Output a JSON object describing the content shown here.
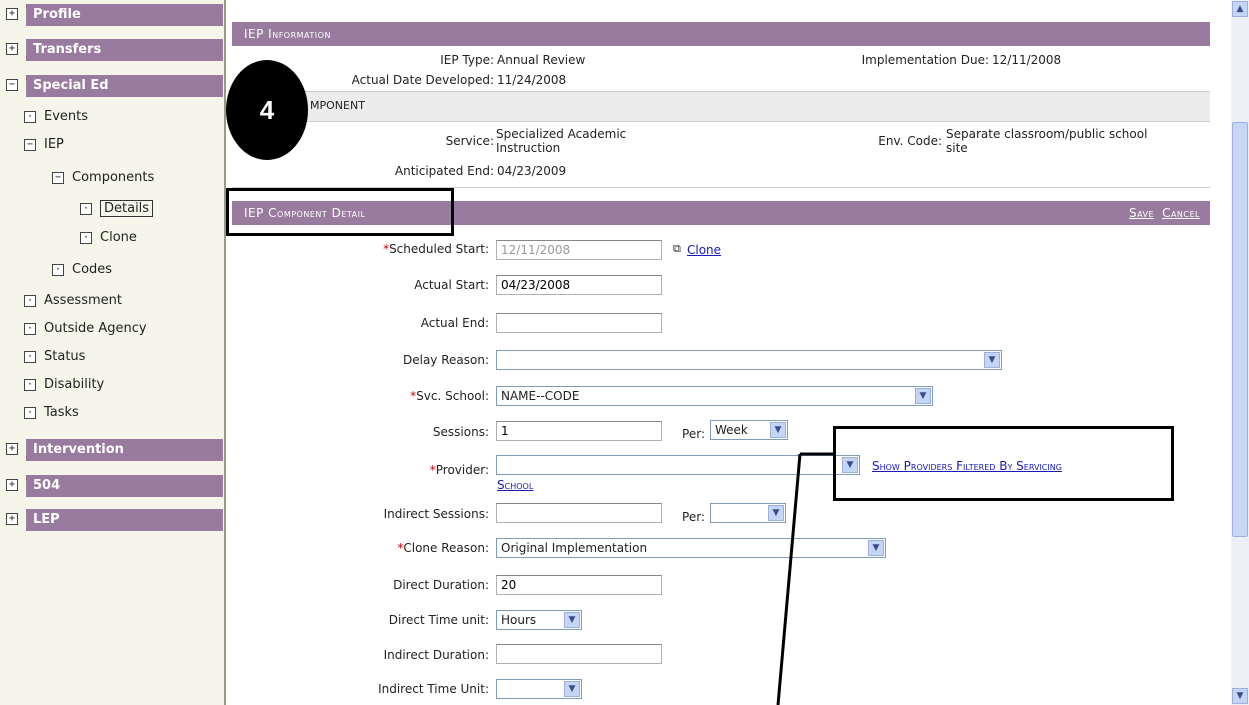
{
  "sidebar": {
    "sections": [
      {
        "label": "Profile",
        "sign": "+"
      },
      {
        "label": "Transfers",
        "sign": "+"
      },
      {
        "label": "Special Ed",
        "sign": "−"
      },
      {
        "label": "Intervention",
        "sign": "+"
      },
      {
        "label": "504",
        "sign": "+"
      },
      {
        "label": "LEP",
        "sign": "+"
      }
    ],
    "tree": {
      "events": "Events",
      "iep": "IEP",
      "components": "Components",
      "details": "Details",
      "clone": "Clone",
      "codes": "Codes",
      "assessment": "Assessment",
      "outside_agency": "Outside Agency",
      "status": "Status",
      "disability": "Disability",
      "tasks": "Tasks"
    }
  },
  "iep_info": {
    "header": "IEP Information",
    "iep_type_label": "IEP Type:",
    "iep_type": "Annual Review",
    "impl_due_label": "Implementation Due:",
    "impl_due": "12/11/2008",
    "actual_dev_label": "Actual Date Developed:",
    "actual_dev": "11/24/2008",
    "component_header": "MPONENT",
    "service_label": "Service:",
    "service_line1": "Specialized Academic",
    "service_line2": "Instruction",
    "env_label": "Env. Code:",
    "env_line1": "Separate classroom/public school",
    "env_line2": "site",
    "anticipated_label": "Anticipated End:",
    "anticipated": "04/23/2009"
  },
  "detail": {
    "header": "IEP Component Detail",
    "save": "Save",
    "cancel": "Cancel",
    "scheduled_start_label": "Scheduled Start:",
    "scheduled_start": "12/11/2008",
    "clone_link": "Clone",
    "actual_start_label": "Actual Start:",
    "actual_start": "04/23/2008",
    "actual_end_label": "Actual End:",
    "actual_end": "",
    "delay_reason_label": "Delay Reason:",
    "delay_reason": "",
    "svc_school_label": "Svc. School:",
    "svc_school": "NAME--CODE",
    "sessions_label": "Sessions:",
    "sessions": "1",
    "per_label": "Per:",
    "per": "Week",
    "provider_label": "Provider:",
    "provider": "",
    "show_providers_1": "Show Providers Filtered By Servicing",
    "show_providers_2": "School",
    "indirect_sessions_label": "Indirect Sessions:",
    "indirect_sessions": "",
    "per2_label": "Per:",
    "per2": "",
    "clone_reason_label": "Clone Reason:",
    "clone_reason": "Original Implementation",
    "direct_duration_label": "Direct Duration:",
    "direct_duration": "20",
    "direct_time_unit_label": "Direct Time unit:",
    "direct_time_unit": "Hours",
    "indirect_duration_label": "Indirect Duration:",
    "indirect_duration": "",
    "indirect_time_unit_label": "Indirect Time Unit:",
    "indirect_time_unit": ""
  },
  "callout": {
    "number": "4"
  },
  "colors": {
    "header_bg": "#9a7ba0",
    "link": "#1a1ab5",
    "required": "#d40000",
    "sidebar_bg": "#f5f5e9"
  }
}
